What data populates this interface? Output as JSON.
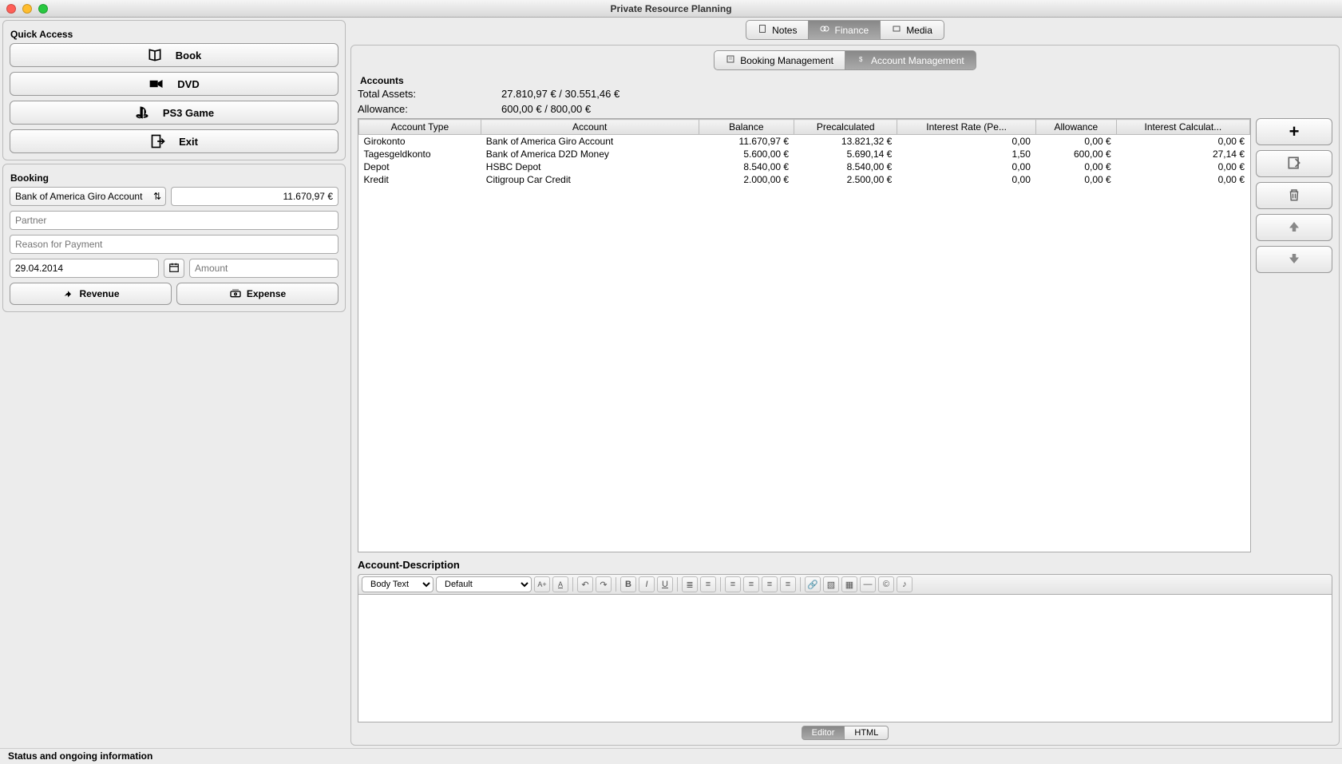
{
  "window": {
    "title": "Private Resource Planning"
  },
  "quick_access": {
    "title": "Quick Access",
    "book_label": "Book",
    "dvd_label": "DVD",
    "ps3_label": "PS3 Game",
    "exit_label": "Exit"
  },
  "booking": {
    "title": "Booking",
    "account_selected": "Bank of America Giro Account",
    "balance_display": "11.670,97 €",
    "partner_placeholder": "Partner",
    "reason_placeholder": "Reason for Payment",
    "date_value": "29.04.2014",
    "amount_placeholder": "Amount",
    "revenue_label": "Revenue",
    "expense_label": "Expense"
  },
  "main_tabs": {
    "notes": "Notes",
    "finance": "Finance",
    "media": "Media"
  },
  "sub_tabs": {
    "booking_mgmt": "Booking Management",
    "account_mgmt": "Account Management"
  },
  "accounts": {
    "title": "Accounts",
    "total_assets_label": "Total Assets:",
    "total_assets_value": "27.810,97 €  /  30.551,46 €",
    "allowance_label": "Allowance:",
    "allowance_value": "600,00 €  /  800,00 €",
    "columns": [
      "Account Type",
      "Account",
      "Balance",
      "Precalculated",
      "Interest Rate (Pe...",
      "Allowance",
      "Interest Calculat..."
    ],
    "rows": [
      {
        "type": "Girokonto",
        "account": "Bank of America Giro Account",
        "balance": "11.670,97 €",
        "precalc": "13.821,32 €",
        "rate": "0,00",
        "allowance": "0,00 €",
        "interest": "0,00 €"
      },
      {
        "type": "Tagesgeldkonto",
        "account": "Bank of America D2D Money",
        "balance": "5.600,00 €",
        "precalc": "5.690,14 €",
        "rate": "1,50",
        "allowance": "600,00 €",
        "interest": "27,14 €"
      },
      {
        "type": "Depot",
        "account": "HSBC Depot",
        "balance": "8.540,00 €",
        "precalc": "8.540,00 €",
        "rate": "0,00",
        "allowance": "0,00 €",
        "interest": "0,00 €"
      },
      {
        "type": "Kredit",
        "account": "Citigroup Car Credit",
        "balance": "2.000,00 €",
        "precalc": "2.500,00 €",
        "rate": "0,00",
        "allowance": "0,00 €",
        "interest": "0,00 €"
      }
    ]
  },
  "description": {
    "title": "Account-Description",
    "style_selected": "Body Text",
    "font_selected": "Default",
    "editor_tab": "Editor",
    "html_tab": "HTML"
  },
  "statusbar": "Status and ongoing information"
}
